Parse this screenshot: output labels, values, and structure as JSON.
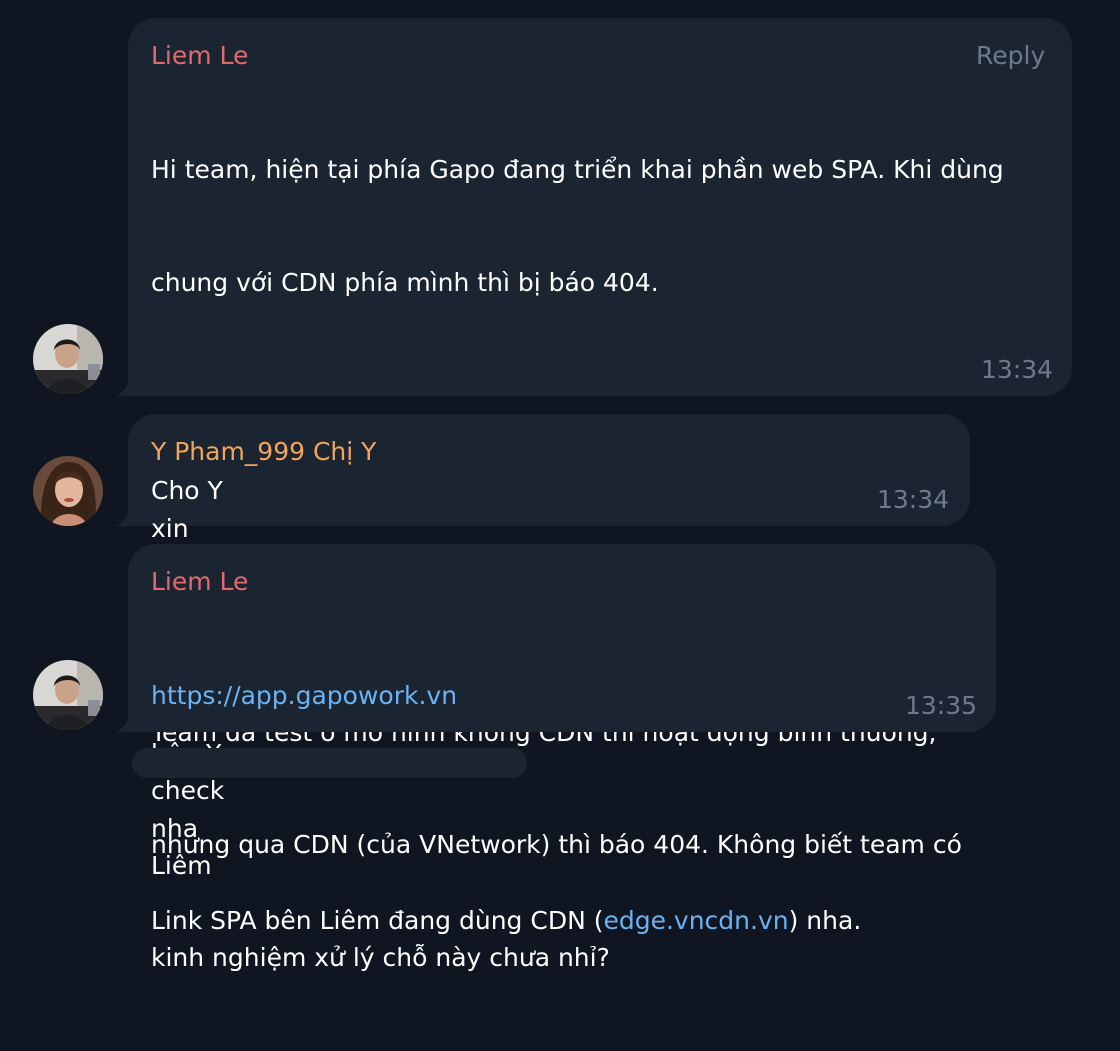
{
  "colors": {
    "background": "#0f1621",
    "bubble": "#1b2532",
    "text": "#ffffff",
    "meta": "#6c7a8b",
    "link": "#6ab2f2",
    "sender_liem": "#e16a6f",
    "sender_y": "#f2a45a"
  },
  "messages": [
    {
      "sender": "Liem Le",
      "reply": "Reply",
      "lines": [
        "Hi team, hiện tại phía Gapo đang triển khai phần web SPA. Khi dùng",
        "chung với CDN phía mình thì bị báo 404.",
        "",
        "",
        "---",
        "Team đã test ở mô hình không CDN thì hoạt động bình thường,",
        "nhưng qua CDN (của VNetwork) thì báo 404. Không biết team có",
        "kinh nghiệm xử lý chỗ này chưa nhỉ?"
      ],
      "time": "13:34",
      "avatar_icon": "man-portrait-avatar"
    },
    {
      "sender": "Y Pham_999 Chị Y",
      "text": "Cho Y xin link và hình báo lỗi để bên Y check nha Liêm",
      "time": "13:34",
      "avatar_icon": "woman-portrait-avatar"
    },
    {
      "sender": "Liem Le",
      "link": "https://app.gapowork.vn",
      "text_before": "Link SPA bên Liêm đang dùng CDN (",
      "inline_link": "edge.vncdn.vn",
      "text_after": ") nha.",
      "time": "13:35",
      "avatar_icon": "man-portrait-avatar"
    }
  ]
}
